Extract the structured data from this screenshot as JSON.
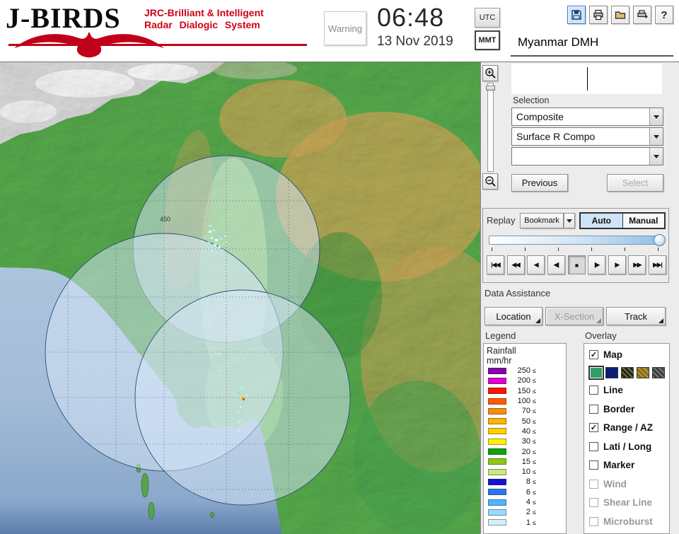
{
  "header": {
    "logo": {
      "title": "J-BIRDS",
      "subtitle1": "JRC-Brilliant & Intelligent",
      "subtitle2": "Radar Dialogic System"
    },
    "warning_label": "Warning",
    "clock": {
      "time": "06:48",
      "date": "13 Nov 2019"
    },
    "timezone": {
      "utc": "UTC",
      "mmt": "MMT",
      "selected": "MMT"
    },
    "station": "Myanmar DMH",
    "toolbar": {
      "icons": [
        "save-icon",
        "print-icon",
        "folder-icon",
        "print-setup-icon",
        "help-icon"
      ],
      "help_glyph": "?"
    }
  },
  "selection": {
    "label": "Selection",
    "combo1": "Composite",
    "combo2": "Surface R Compo",
    "combo3": "",
    "previous_label": "Previous",
    "select_label": "Select"
  },
  "replay": {
    "label": "Replay",
    "bookmark_label": "Bookmark",
    "auto_label": "Auto",
    "manual_label": "Manual",
    "mode": "Auto",
    "playback": [
      {
        "name": "skip-to-start",
        "glyph": "|◀◀",
        "active": false
      },
      {
        "name": "fast-rewind",
        "glyph": "◀◀",
        "active": false
      },
      {
        "name": "play-reverse",
        "glyph": "◀",
        "active": false
      },
      {
        "name": "step-back",
        "glyph": "◀|",
        "active": false
      },
      {
        "name": "stop",
        "glyph": "■",
        "active": true
      },
      {
        "name": "step-forward",
        "glyph": "|▶",
        "active": false
      },
      {
        "name": "play",
        "glyph": "▶",
        "active": false
      },
      {
        "name": "fast-forward",
        "glyph": "▶▶",
        "active": false
      },
      {
        "name": "skip-to-end",
        "glyph": "▶▶|",
        "active": false
      }
    ]
  },
  "data_assistance": {
    "label": "Data Assistance",
    "buttons": [
      {
        "label": "Location",
        "enabled": true
      },
      {
        "label": "X-Section",
        "enabled": false
      },
      {
        "label": "Track",
        "enabled": true
      }
    ]
  },
  "legend": {
    "label": "Legend",
    "title": "Rainfall",
    "unit": "mm/hr",
    "le_symbol": "≤",
    "scale": [
      {
        "value": "250",
        "color": "#8800a8"
      },
      {
        "value": "200",
        "color": "#e000d0"
      },
      {
        "value": "150",
        "color": "#ff1400"
      },
      {
        "value": "100",
        "color": "#ff5a00"
      },
      {
        "value": "70",
        "color": "#ff8c00"
      },
      {
        "value": "50",
        "color": "#ffb400"
      },
      {
        "value": "40",
        "color": "#ffd200"
      },
      {
        "value": "30",
        "color": "#fff000"
      },
      {
        "value": "20",
        "color": "#10a010"
      },
      {
        "value": "15",
        "color": "#8cc814"
      },
      {
        "value": "10",
        "color": "#c8e882"
      },
      {
        "value": "8",
        "color": "#1414d2"
      },
      {
        "value": "6",
        "color": "#2878f0"
      },
      {
        "value": "4",
        "color": "#50b4ff"
      },
      {
        "value": "2",
        "color": "#96dcff"
      },
      {
        "value": "1",
        "color": "#d2f0fa"
      }
    ]
  },
  "overlay": {
    "label": "Overlay",
    "check_glyph": "✓",
    "map_item": {
      "label": "Map",
      "checked": true
    },
    "map_swatches": [
      "#2e9e68",
      "#0a1e78",
      "#26260a",
      "#8a6a00",
      "#3c3c3c"
    ],
    "items": [
      {
        "label": "Line",
        "checked": false,
        "enabled": true
      },
      {
        "label": "Border",
        "checked": false,
        "enabled": true
      },
      {
        "label": "Range / AZ",
        "checked": true,
        "enabled": true
      },
      {
        "label": "Lati / Long",
        "checked": false,
        "enabled": true
      },
      {
        "label": "Marker",
        "checked": false,
        "enabled": true
      },
      {
        "label": "Wind",
        "checked": false,
        "enabled": false
      },
      {
        "label": "Shear Line",
        "checked": false,
        "enabled": false
      },
      {
        "label": "Microburst",
        "checked": false,
        "enabled": false
      }
    ]
  },
  "map": {
    "range_label": "450"
  }
}
